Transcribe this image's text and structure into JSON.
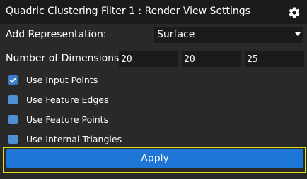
{
  "window": {
    "title": "Quadric Clustering Filter 1 : Render View Settings",
    "settings_icon": "gear-icon"
  },
  "representation": {
    "label": "Add Representation:",
    "selected": "Surface"
  },
  "dimensions": {
    "label": "Number of Dimensions :",
    "values": [
      "20",
      "20",
      "25"
    ]
  },
  "options": [
    {
      "label": "Use Input Points",
      "checked": true
    },
    {
      "label": "Use Feature Edges",
      "checked": false
    },
    {
      "label": "Use Feature Points",
      "checked": false
    },
    {
      "label": "Use Internal Triangles",
      "checked": false
    }
  ],
  "apply": {
    "label": "Apply",
    "color": "#1e77d6",
    "highlight_color": "#e6e01a"
  }
}
